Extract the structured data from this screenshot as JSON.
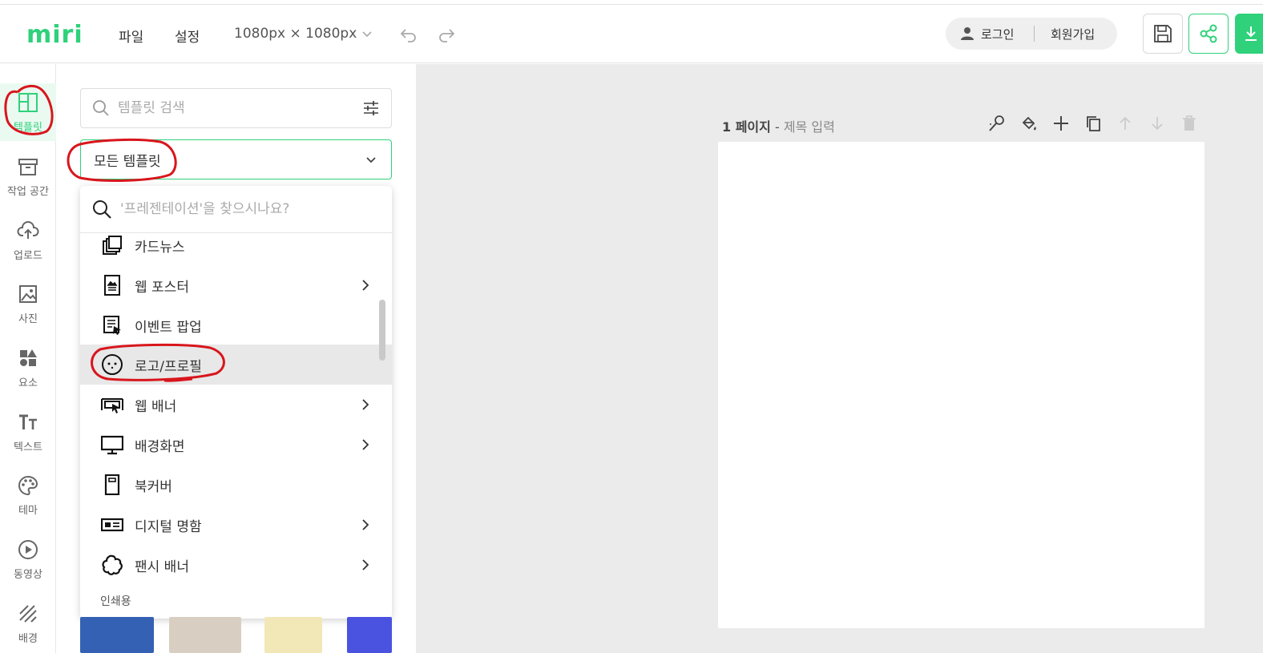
{
  "app": {
    "logo": "miri"
  },
  "menu": {
    "file": "파일",
    "settings": "설정",
    "size": "1080px × 1080px"
  },
  "auth": {
    "login": "로그인",
    "signup": "회원가입"
  },
  "leftnav": [
    {
      "label": "템플릿",
      "icon": "template-icon"
    },
    {
      "label": "작업 공간",
      "icon": "workspace-icon"
    },
    {
      "label": "업로드",
      "icon": "upload-icon"
    },
    {
      "label": "사진",
      "icon": "photo-icon"
    },
    {
      "label": "요소",
      "icon": "element-icon"
    },
    {
      "label": "텍스트",
      "icon": "text-icon"
    },
    {
      "label": "테마",
      "icon": "palette-icon"
    },
    {
      "label": "동영상",
      "icon": "video-icon"
    },
    {
      "label": "배경",
      "icon": "background-icon"
    }
  ],
  "panel": {
    "search_placeholder": "템플릿 검색",
    "category_selected": "모든 템플릿",
    "popup_search_placeholder": "'프레젠테이션'을 찾으시나요?",
    "items": [
      {
        "label": "카드뉴스",
        "icon": "cardnews-icon",
        "has_submenu": false
      },
      {
        "label": "웹 포스터",
        "icon": "web-poster-icon",
        "has_submenu": true
      },
      {
        "label": "이벤트 팝업",
        "icon": "event-popup-icon",
        "has_submenu": false
      },
      {
        "label": "로고/프로필",
        "icon": "logo-profile-icon",
        "has_submenu": false,
        "highlighted": true
      },
      {
        "label": "웹 배너",
        "icon": "web-banner-icon",
        "has_submenu": true
      },
      {
        "label": "배경화면",
        "icon": "monitor-icon",
        "has_submenu": true
      },
      {
        "label": "북커버",
        "icon": "book-cover-icon",
        "has_submenu": false
      },
      {
        "label": "디지털 명함",
        "icon": "business-card-icon",
        "has_submenu": true
      },
      {
        "label": "팬시 배너",
        "icon": "fancy-banner-icon",
        "has_submenu": true
      }
    ],
    "section_print": "인쇄용"
  },
  "canvas": {
    "page_number": "1 페이지",
    "title_separator": " - ",
    "title_placeholder": "제목 입력"
  },
  "colors": {
    "brand": "#2fd17a",
    "annotation": "#d8161d"
  }
}
